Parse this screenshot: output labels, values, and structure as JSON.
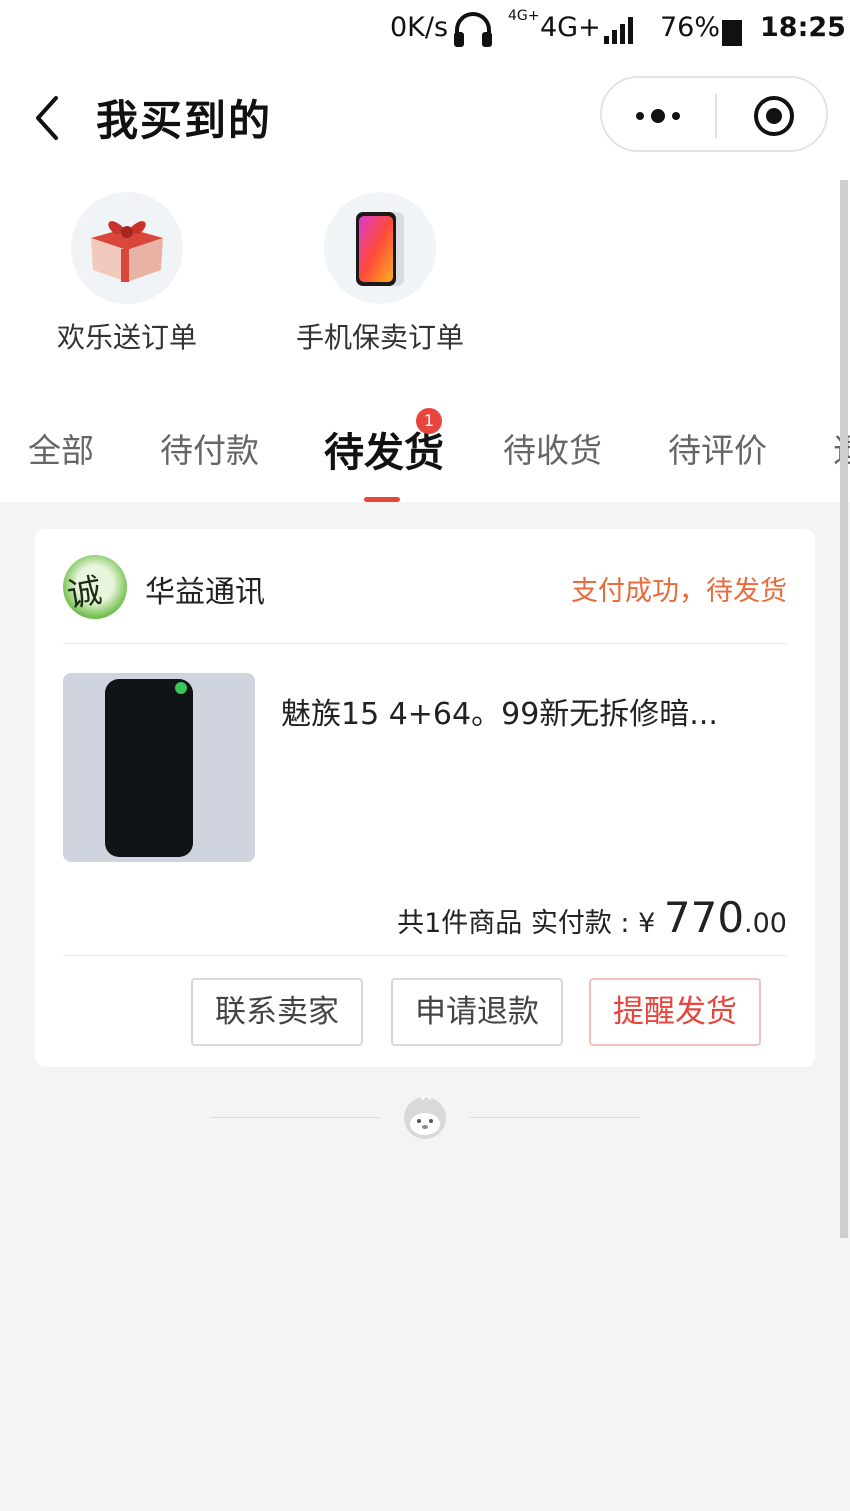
{
  "status_bar": {
    "speed": "0K/s",
    "network_small": "4G+",
    "network": "4G+",
    "battery": "76%",
    "time": "18:25"
  },
  "header": {
    "title": "我买到的",
    "icons": [
      "back-icon",
      "more-icon",
      "target-icon"
    ]
  },
  "quick_entries": [
    {
      "label": "欢乐送订单",
      "icon": "gift-icon"
    },
    {
      "label": "手机保卖订单",
      "icon": "phone-icon"
    }
  ],
  "tabs": [
    {
      "label": "全部",
      "active": false
    },
    {
      "label": "待付款",
      "active": false
    },
    {
      "label": "待发货",
      "active": true,
      "badge": "1"
    },
    {
      "label": "待收货",
      "active": false
    },
    {
      "label": "待评价",
      "active": false
    },
    {
      "label": "退",
      "active": false
    }
  ],
  "order": {
    "shop_name": "华益通讯",
    "shop_avatar_text": "诚信",
    "status": "支付成功，待发货",
    "product_title": "魅族15 4+64。99新无拆修暗...",
    "summary_prefix": "共1件商品  实付款 : ¥ ",
    "price_int": "770",
    "price_dec": ".00",
    "buttons": [
      "联系卖家",
      "申请退款",
      "提醒发货"
    ]
  },
  "colors": {
    "accent": "#e8453c",
    "status_orange": "#e86b3a",
    "background": "#f4f4f4"
  }
}
